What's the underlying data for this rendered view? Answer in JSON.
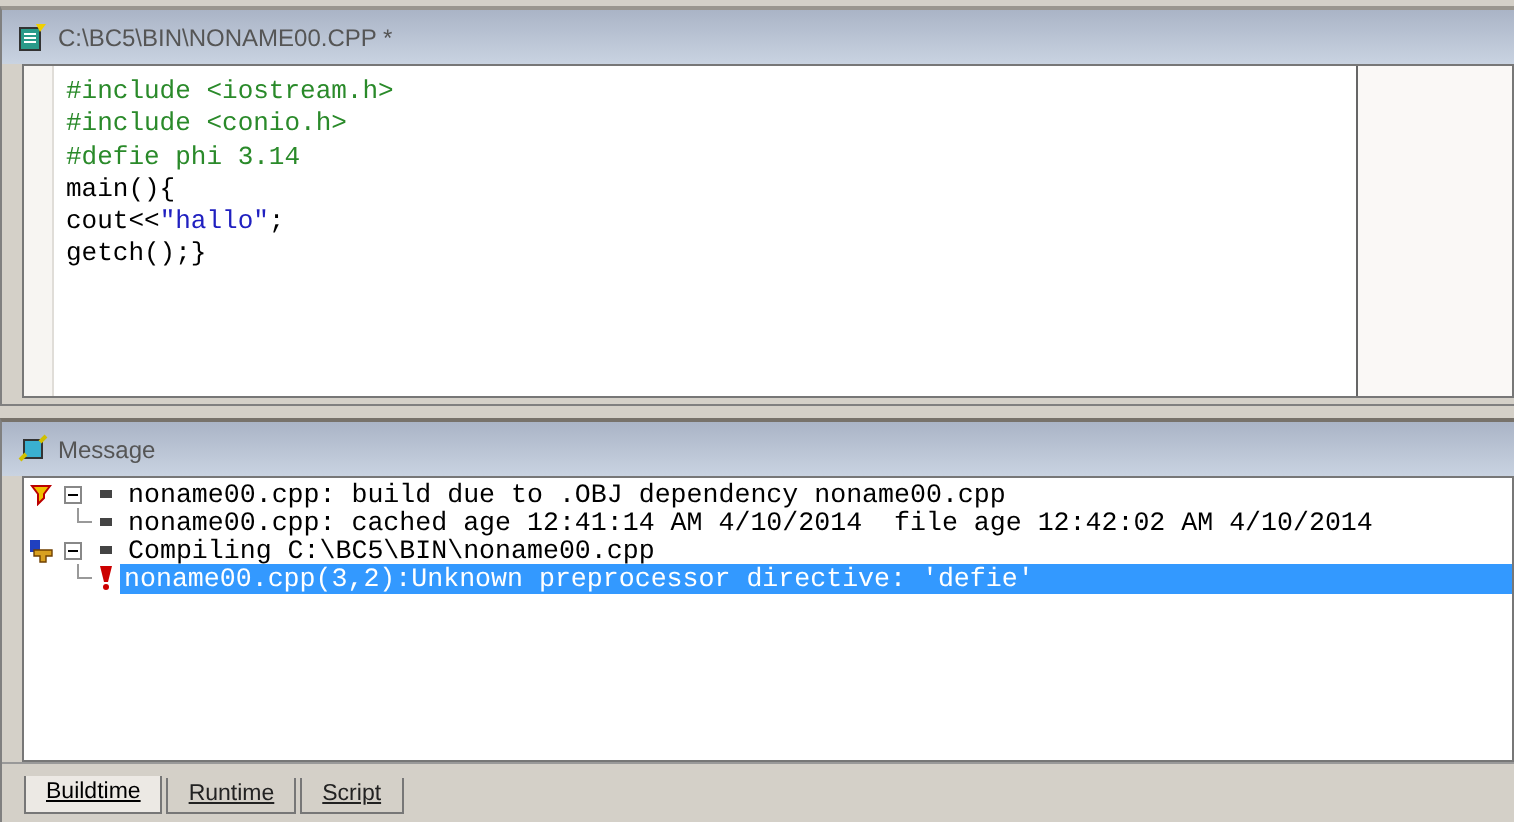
{
  "editor": {
    "title": "C:\\BC5\\BIN\\NONAME00.CPP *",
    "lines": [
      [
        {
          "kind": "directive",
          "text": "#include <iostream.h>"
        }
      ],
      [
        {
          "kind": "directive",
          "text": "#include <conio.h>"
        }
      ],
      [
        {
          "kind": "directive",
          "text": "#defie phi 3.14"
        }
      ],
      [
        {
          "kind": "plain",
          "text": "main(){"
        }
      ],
      [
        {
          "kind": "plain",
          "text": "cout<<"
        },
        {
          "kind": "string",
          "text": "\"hallo\""
        },
        {
          "kind": "plain",
          "text": ";"
        }
      ],
      [
        {
          "kind": "plain",
          "text": "getch();}"
        }
      ]
    ]
  },
  "messages": {
    "title": "Message",
    "items": [
      {
        "kind": "make",
        "expanded": true,
        "selected": false,
        "text": "noname00.cpp: build due to .OBJ dependency noname00.cpp",
        "children": [
          {
            "kind": "bullet",
            "selected": false,
            "text": "noname00.cpp: cached age 12:41:14 AM 4/10/2014  file age 12:42:02 AM 4/10/2014"
          }
        ]
      },
      {
        "kind": "compile",
        "expanded": true,
        "selected": false,
        "text": "Compiling C:\\BC5\\BIN\\noname00.cpp",
        "children": [
          {
            "kind": "error",
            "selected": true,
            "text": "noname00.cpp(3,2):Unknown preprocessor directive: 'defie'"
          }
        ]
      }
    ],
    "tabs": [
      {
        "label": "Buildtime",
        "selected": true
      },
      {
        "label": "Runtime",
        "selected": false
      },
      {
        "label": "Script",
        "selected": false
      }
    ]
  }
}
